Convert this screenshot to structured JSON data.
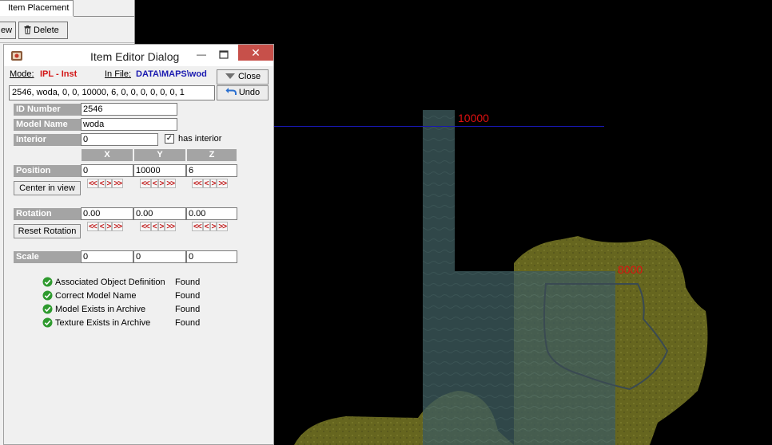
{
  "host": {
    "tab_label": "Item Placement",
    "view_button": "ew",
    "delete_button": "Delete"
  },
  "dialog": {
    "title": "Item Editor Dialog",
    "mode_label": "Mode:",
    "mode_value": "IPL - Inst",
    "infile_label": "In File:",
    "infile_value": "DATA\\MAPS\\wod",
    "close_button": "Close",
    "undo_button": "Undo",
    "ipl_line": "2546, woda, 0, 0, 10000, 6, 0, 0, 0, 0, 0, 0, 1",
    "id_number_label": "ID Number",
    "id_number_value": "2546",
    "model_name_label": "Model Name",
    "model_name_value": "woda",
    "interior_label": "Interior",
    "interior_value": "0",
    "has_interior_label": "has interior",
    "has_interior_checked": true,
    "axis_x": "X",
    "axis_y": "Y",
    "axis_z": "Z",
    "position_label": "Position",
    "position": {
      "x": "0",
      "y": "10000",
      "z": "6"
    },
    "center_in_view_button": "Center in view",
    "rotation_label": "Rotation",
    "rotation": {
      "x": "0.00",
      "y": "0.00",
      "z": "0.00"
    },
    "reset_rotation_button": "Reset Rotation",
    "scale_label": "Scale",
    "scale": {
      "x": "0",
      "y": "0",
      "z": "0"
    },
    "arrow_buttons": [
      "<<",
      "<",
      ">",
      ">>"
    ],
    "checks": [
      {
        "label": "Associated Object Definition",
        "status": "Found"
      },
      {
        "label": "Correct Model Name",
        "status": "Found"
      },
      {
        "label": "Model Exists in Archive",
        "status": "Found"
      },
      {
        "label": "Texture Exists in Archive",
        "status": "Found"
      }
    ]
  },
  "viewport": {
    "label_top": "10000",
    "label_right": "8000"
  },
  "colors": {
    "mode_red": "#d21616",
    "file_blue": "#1a1ab0",
    "map_label_red": "#e01010",
    "grass": "#6b6b22",
    "water": "#3f5e60",
    "status_ok": "#2e9a2e"
  }
}
